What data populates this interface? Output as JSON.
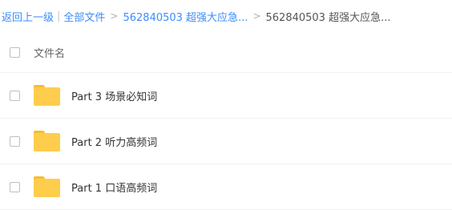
{
  "breadcrumb": {
    "back_label": "返回上一级",
    "separator": "|",
    "all_files_label": "全部文件",
    "arrow": ">",
    "folder_label": "562840503 超强大应急...",
    "current_label": "562840503 超强大应急..."
  },
  "list_header": {
    "name_column": "文件名"
  },
  "files": [
    {
      "name": "Part 3 场景必知词",
      "icon": "folder-icon"
    },
    {
      "name": "Part 2 听力高频词",
      "icon": "folder-icon"
    },
    {
      "name": "Part 1 口语高频词",
      "icon": "folder-icon"
    }
  ],
  "colors": {
    "link": "#3b8cff",
    "folder": "#ffcd4c",
    "folder_tab": "#f7bc33"
  }
}
